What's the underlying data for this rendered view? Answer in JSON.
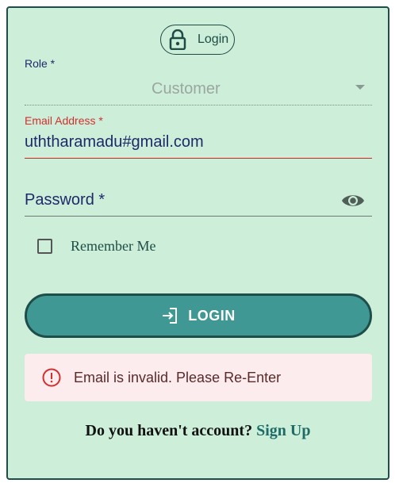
{
  "header": {
    "badge_label": "Login",
    "badge_icon": "lock-icon"
  },
  "form": {
    "role": {
      "label": "Role *",
      "value": "Customer"
    },
    "email": {
      "label": "Email Address *",
      "value": "uththaramadu#gmail.com"
    },
    "password": {
      "label": "Password *",
      "toggle_icon": "eye-icon"
    },
    "remember": {
      "label": "Remember Me",
      "checked": false
    },
    "submit_label": "LOGIN",
    "submit_icon": "login-icon"
  },
  "alert": {
    "message": "Email is invalid. Please Re-Enter",
    "icon": "error-circle-icon"
  },
  "footer": {
    "prompt": "Do you haven't account?",
    "link": "Sign Up"
  },
  "colors": {
    "card_background": "#cdeed8",
    "primary": "#409894",
    "error": "#d32f2f",
    "text": "#1f2a6b"
  }
}
